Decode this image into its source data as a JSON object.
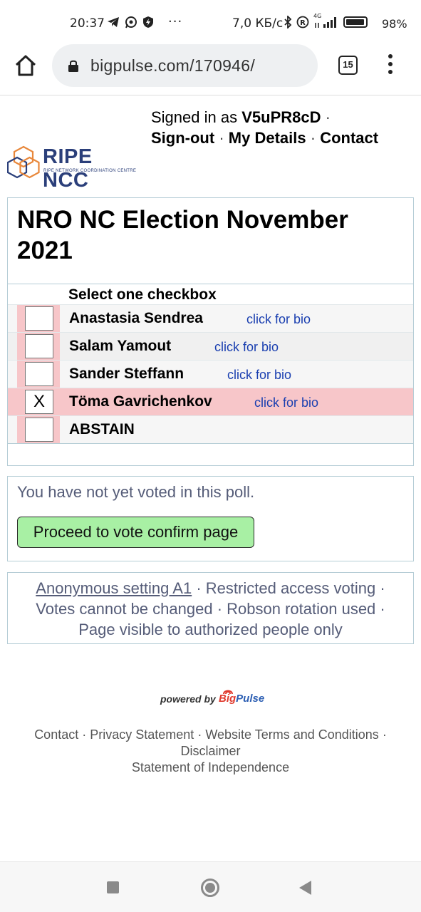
{
  "status_bar": {
    "time": "20:37",
    "speed": "7,0 КБ/с",
    "network": "4G",
    "battery": "98%",
    "overflow": "···"
  },
  "browser": {
    "url": "bigpulse.com/170946/",
    "tab_count": "15"
  },
  "header": {
    "signed_in_prefix": "Signed in as",
    "username": "V5uPR8cD",
    "links": [
      "Sign-out",
      "My Details",
      "Contact"
    ],
    "separator": "·",
    "logo_title": "RIPE NCC",
    "logo_subtitle": "RIPE NETWORK COORDINATION CENTRE"
  },
  "election": {
    "title": "NRO NC Election November 2021",
    "instruction": "Select one checkbox",
    "bio_link": "click for bio",
    "candidates": [
      {
        "name": "Anastasia Sendrea",
        "mark": "",
        "has_bio": true
      },
      {
        "name": "Salam Yamout",
        "mark": "",
        "has_bio": true
      },
      {
        "name": "Sander Steffann",
        "mark": "",
        "has_bio": true
      },
      {
        "name": "Töma Gavrichenkov",
        "mark": "X",
        "has_bio": true,
        "selected": true
      },
      {
        "name": "ABSTAIN",
        "mark": "",
        "has_bio": false
      }
    ]
  },
  "vote": {
    "status": "You have not yet voted in this poll.",
    "proceed_label": "Proceed to vote confirm page"
  },
  "settings": {
    "anonymous": "Anonymous setting A1",
    "restricted": "Restricted access voting",
    "cannot_change": "Votes cannot be changed",
    "robson": "Robson rotation used",
    "visibility": "Page visible to authorized people only"
  },
  "powered_by": {
    "prefix": "powered by",
    "brand_big": "Big",
    "brand_pulse": "Pulse"
  },
  "footer": {
    "contact": "Contact",
    "privacy": "Privacy Statement",
    "terms": "Website Terms and Conditions",
    "disclaimer": "Disclaimer",
    "independence": "Statement of Independence"
  },
  "colors": {
    "selected_row": "#f7c6c9",
    "proceed_button": "#a8f0a4",
    "bio_link": "#1a3fb0",
    "logo": "#2b3f7a"
  }
}
